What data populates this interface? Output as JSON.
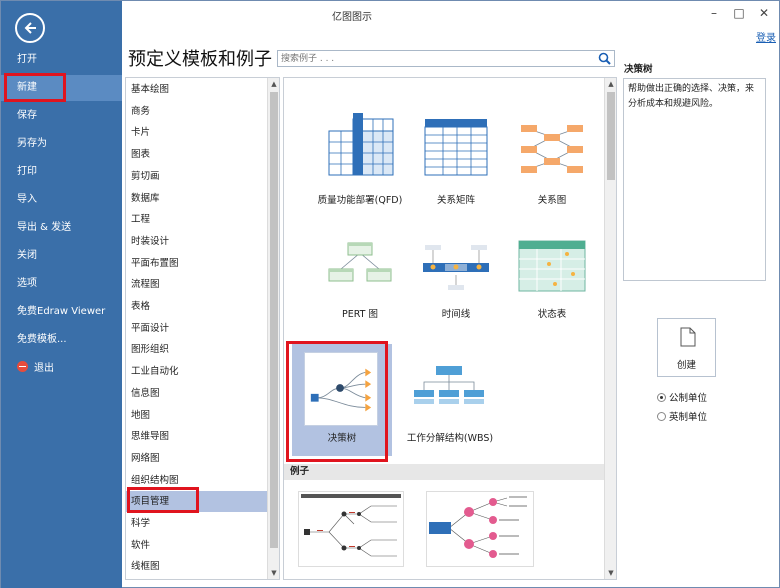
{
  "window": {
    "title": "亿图图示",
    "login_label": "登录"
  },
  "nav": {
    "items": [
      {
        "label": "打开"
      },
      {
        "label": "新建",
        "active": true
      },
      {
        "label": "保存"
      },
      {
        "label": "另存为"
      },
      {
        "label": "打印"
      },
      {
        "label": "导入"
      },
      {
        "label": "导出 & 发送"
      },
      {
        "label": "关闭"
      },
      {
        "label": "选项"
      },
      {
        "label": "免费Edraw Viewer"
      },
      {
        "label": "免费模板..."
      },
      {
        "label": "退出",
        "icon": "exit-icon"
      }
    ]
  },
  "main": {
    "heading": "预定义模板和例子",
    "search_placeholder": "搜索例子 . . .",
    "categories": [
      "基本绘图",
      "商务",
      "卡片",
      "图表",
      "剪切画",
      "数据库",
      "工程",
      "时装设计",
      "平面布置图",
      "流程图",
      "表格",
      "平面设计",
      "图形组织",
      "工业自动化",
      "信息图",
      "地图",
      "思维导图",
      "网络图",
      "组织结构图",
      "项目管理",
      "科学",
      "软件",
      "线框图"
    ],
    "selected_category": "项目管理",
    "templates": [
      {
        "label": "质量功能部署(QFD)",
        "icon": "qfd-icon"
      },
      {
        "label": "关系矩阵",
        "icon": "relation-matrix-icon"
      },
      {
        "label": "关系图",
        "icon": "relation-diagram-icon"
      },
      {
        "label": "PERT 图",
        "icon": "pert-icon"
      },
      {
        "label": "时间线",
        "icon": "timeline-icon"
      },
      {
        "label": "状态表",
        "icon": "status-table-icon"
      },
      {
        "label": "决策树",
        "icon": "decision-tree-icon",
        "selected": true
      },
      {
        "label": "工作分解结构(WBS)",
        "icon": "wbs-icon"
      }
    ],
    "examples_header": "例子"
  },
  "right_panel": {
    "title": "决策树",
    "description": "帮助做出正确的选择、决策，来分析成本和规避风险。",
    "create_label": "创建",
    "units": [
      {
        "label": "公制单位",
        "checked": true
      },
      {
        "label": "英制单位",
        "checked": false
      }
    ]
  },
  "colors": {
    "nav_bg": "#3a6fa9",
    "nav_active": "#5b8bc2",
    "selection": "#b2c2e1",
    "highlight": "#e0141e"
  }
}
